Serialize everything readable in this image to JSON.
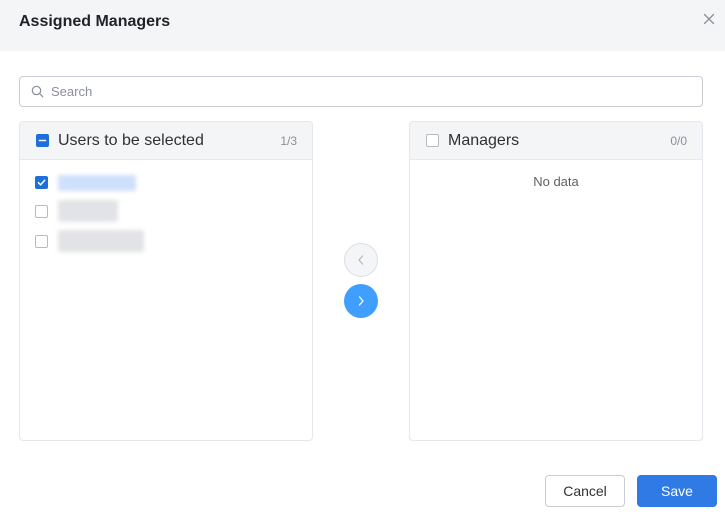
{
  "dialog": {
    "title": "Assigned Managers",
    "close_icon": "close-icon"
  },
  "search": {
    "placeholder": "Search",
    "value": "",
    "icon": "search-icon"
  },
  "left_panel": {
    "title": "Users to be selected",
    "count": "1/3",
    "header_checkbox_state": "indeterminate",
    "items": [
      {
        "checked": true
      },
      {
        "checked": false
      },
      {
        "checked": false
      }
    ]
  },
  "right_panel": {
    "title": "Managers",
    "count": "0/0",
    "header_checkbox_state": "unchecked",
    "empty_text": "No data"
  },
  "transfer": {
    "left_icon": "chevron-left-icon",
    "right_icon": "chevron-right-icon"
  },
  "footer": {
    "cancel_label": "Cancel",
    "save_label": "Save"
  },
  "colors": {
    "accent": "#409eff",
    "primary_button": "#2f7ae5",
    "checkbox_checked": "#1e6fd9"
  }
}
